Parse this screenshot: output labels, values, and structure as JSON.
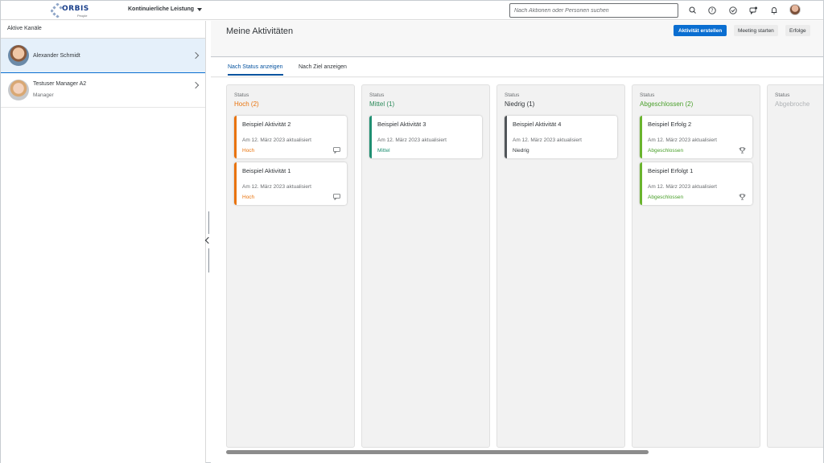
{
  "shell": {
    "logo_text": "ORBIS",
    "logo_sub": "People",
    "app_title": "Kontinuierliche Leistung",
    "search_placeholder": "Nach Aktionen oder Personen suchen",
    "icons": [
      "search-icon",
      "help-icon",
      "check-circle-icon",
      "feedback-icon",
      "bell-icon"
    ]
  },
  "left": {
    "header": "Aktive Kanäle",
    "channels": [
      {
        "name": "Alexander Schmidt",
        "role": ""
      },
      {
        "name": "Testuser Manager A2",
        "role": "Manager"
      }
    ]
  },
  "main": {
    "title": "Meine Aktivitäten",
    "buttons": {
      "create": "Aktivität erstellen",
      "meeting": "Meeting starten",
      "success": "Erfolge"
    },
    "tabs": [
      "Nach Status anzeigen",
      "Nach Ziel anzeigen"
    ],
    "columns": [
      {
        "status_label": "Status",
        "title": "Hoch (2)",
        "color": "#e9730c",
        "cards": [
          {
            "title": "Beispiel Aktivität 2",
            "date": "Am 12. März 2023 aktualisiert",
            "priority": "Hoch",
            "icon": "comment-icon"
          },
          {
            "title": "Beispiel Aktivität 1",
            "date": "Am 12. März 2023 aktualisiert",
            "priority": "Hoch",
            "icon": "comment-icon"
          }
        ]
      },
      {
        "status_label": "Status",
        "title": "Mittel (1)",
        "color": "#2b8a5a",
        "cards": [
          {
            "title": "Beispiel Aktivität 3",
            "date": "Am 12. März 2023 aktualisiert",
            "priority": "Mittel",
            "icon": ""
          }
        ]
      },
      {
        "status_label": "Status",
        "title": "Niedrig (1)",
        "color": "#32363a",
        "cards": [
          {
            "title": "Beispiel Aktivität 4",
            "date": "Am 12. März 2023 aktualisiert",
            "priority": "Niedrig",
            "icon": ""
          }
        ]
      },
      {
        "status_label": "Status",
        "title": "Abgeschlossen (2)",
        "color": "#4ba02c",
        "cards": [
          {
            "title": "Beispiel Erfolg 2",
            "date": "Am 12. März 2023 aktualisiert",
            "priority": "Abgeschlossen",
            "icon": "trophy-icon"
          },
          {
            "title": "Beispiel Erfolgt 1",
            "date": "Am 12. März 2023 aktualisiert",
            "priority": "Abgeschlossen",
            "icon": "trophy-icon"
          }
        ]
      },
      {
        "status_label": "Status",
        "title": "Abgebroche",
        "color": "#b0b3b6",
        "cards": []
      }
    ]
  },
  "colors": {
    "accent": "#0a6ed1",
    "selected_row": "#e5f0fa",
    "tab_active": "#0854a0"
  }
}
